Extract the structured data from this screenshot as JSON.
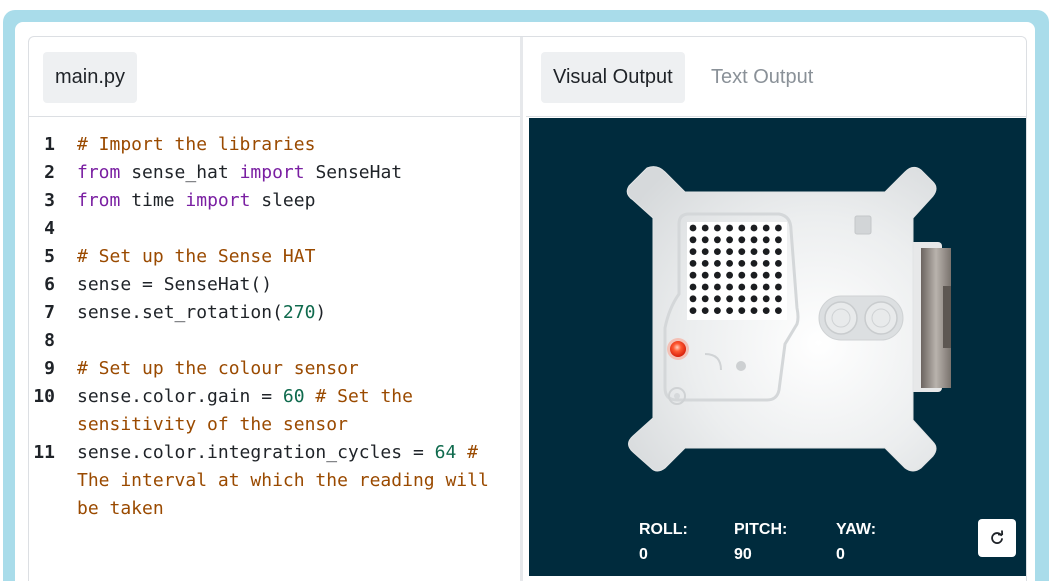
{
  "editor": {
    "file_tab": "main.py",
    "lines": [
      {
        "n": "1",
        "parts": [
          {
            "t": "# Import the libraries",
            "c": "com"
          }
        ]
      },
      {
        "n": "2",
        "parts": [
          {
            "t": "from",
            "c": "kw"
          },
          {
            "t": " sense_hat ",
            "c": "def"
          },
          {
            "t": "import",
            "c": "kw"
          },
          {
            "t": " SenseHat",
            "c": "def"
          }
        ]
      },
      {
        "n": "3",
        "parts": [
          {
            "t": "from",
            "c": "kw"
          },
          {
            "t": " time ",
            "c": "def"
          },
          {
            "t": "import",
            "c": "kw"
          },
          {
            "t": " sleep",
            "c": "def"
          }
        ]
      },
      {
        "n": "4",
        "parts": []
      },
      {
        "n": "5",
        "parts": [
          {
            "t": "# Set up the Sense HAT",
            "c": "com"
          }
        ]
      },
      {
        "n": "6",
        "parts": [
          {
            "t": "sense = SenseHat()",
            "c": "def"
          }
        ]
      },
      {
        "n": "7",
        "parts": [
          {
            "t": "sense.set_rotation(",
            "c": "def"
          },
          {
            "t": "270",
            "c": "num"
          },
          {
            "t": ")",
            "c": "def"
          }
        ]
      },
      {
        "n": "8",
        "parts": []
      },
      {
        "n": "9",
        "parts": [
          {
            "t": "# Set up the colour sensor",
            "c": "com"
          }
        ]
      },
      {
        "n": "10",
        "parts": [
          {
            "t": "sense.color.gain = ",
            "c": "def"
          },
          {
            "t": "60",
            "c": "num"
          },
          {
            "t": " # Set the sensitivity of the sensor",
            "c": "com"
          }
        ]
      },
      {
        "n": "11",
        "parts": [
          {
            "t": "sense.color.integration_cycles = ",
            "c": "def"
          },
          {
            "t": "64",
            "c": "num"
          },
          {
            "t": " # The interval at which the reading will be taken",
            "c": "com"
          }
        ]
      }
    ]
  },
  "output": {
    "tabs": [
      {
        "label": "Visual Output",
        "active": true
      },
      {
        "label": "Text Output",
        "active": false
      }
    ],
    "readouts": {
      "roll": {
        "label": "ROLL:",
        "value": "0"
      },
      "pitch": {
        "label": "PITCH:",
        "value": "90"
      },
      "yaw": {
        "label": "YAW:",
        "value": "0"
      }
    },
    "reset_icon": "refresh-icon"
  },
  "colors": {
    "frame_bg": "#a9dcea",
    "viz_bg": "#002b3d",
    "comment": "#9a4a00",
    "keyword": "#7a1fa2",
    "number": "#0f6a4d",
    "led": "#ff3b1f"
  }
}
